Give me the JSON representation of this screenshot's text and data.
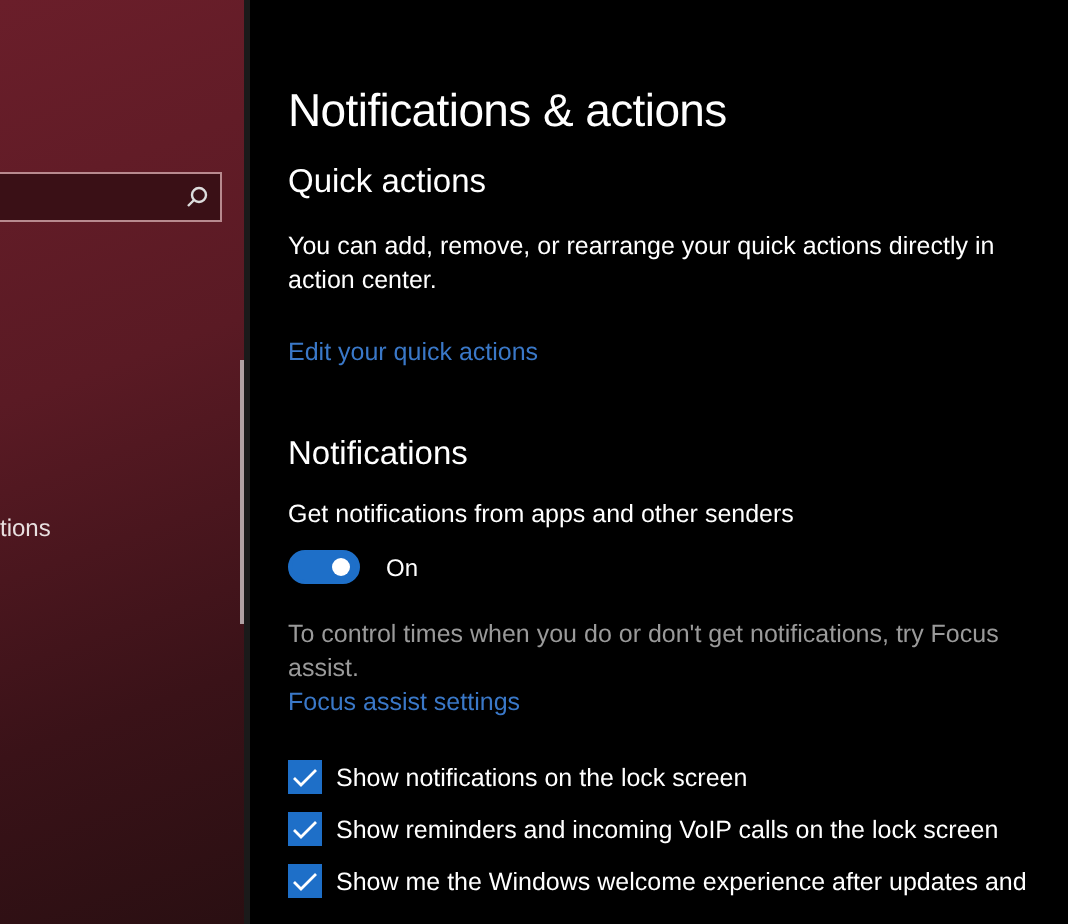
{
  "sidebar": {
    "items": [
      {
        "label": "tions"
      }
    ]
  },
  "page": {
    "title": "Notifications & actions",
    "quick_actions": {
      "heading": "Quick actions",
      "description": "You can add, remove, or rearrange your quick actions directly in action center.",
      "link": "Edit your quick actions"
    },
    "notifications": {
      "heading": "Notifications",
      "toggle": {
        "label": "Get notifications from apps and other senders",
        "on": true,
        "state_text": "On"
      },
      "hint": "To control times when you do or don't get notifications, try Focus assist.",
      "link": "Focus assist settings",
      "options": [
        {
          "label": "Show notifications on the lock screen",
          "checked": true
        },
        {
          "label": "Show reminders and incoming VoIP calls on the lock screen",
          "checked": true
        },
        {
          "label": "Show me the Windows welcome experience after updates and",
          "checked": true
        }
      ]
    }
  }
}
